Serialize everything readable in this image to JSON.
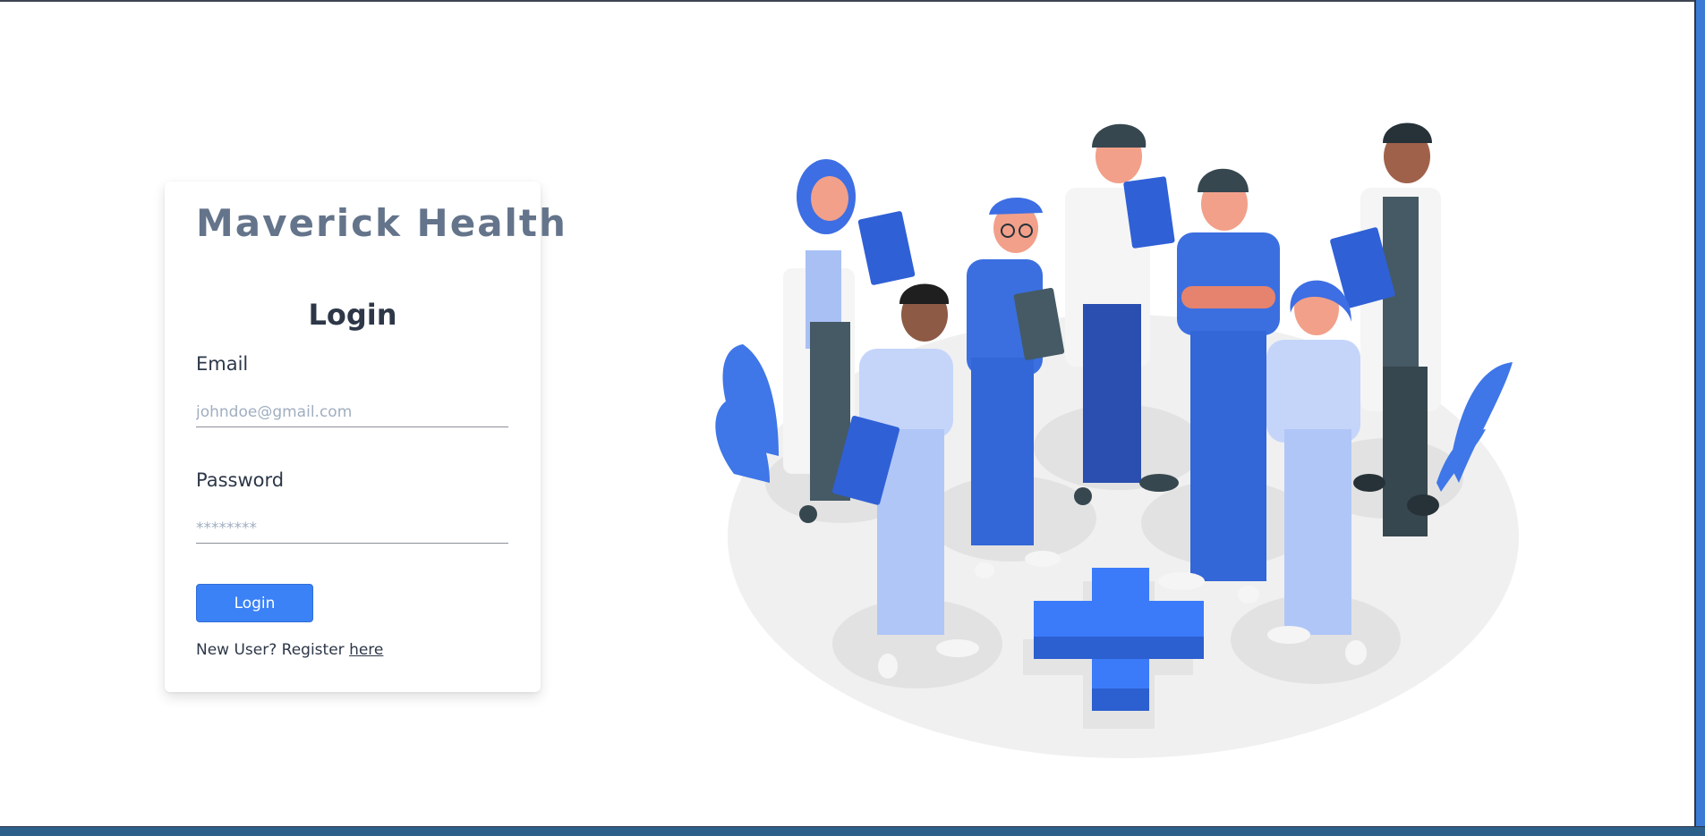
{
  "brand": {
    "name": "Maverick Health"
  },
  "login_form": {
    "title": "Login",
    "email": {
      "label": "Email",
      "placeholder": "johndoe@gmail.com",
      "value": ""
    },
    "password": {
      "label": "Password",
      "placeholder": "********",
      "value": ""
    },
    "submit_label": "Login",
    "register": {
      "prompt": "New User? Register",
      "link_text": "here"
    }
  },
  "colors": {
    "accent": "#3b82f6",
    "brand_text": "#64748b",
    "heading_text": "#2d3748"
  },
  "illustration": {
    "icon": "medical-team-illustration"
  }
}
